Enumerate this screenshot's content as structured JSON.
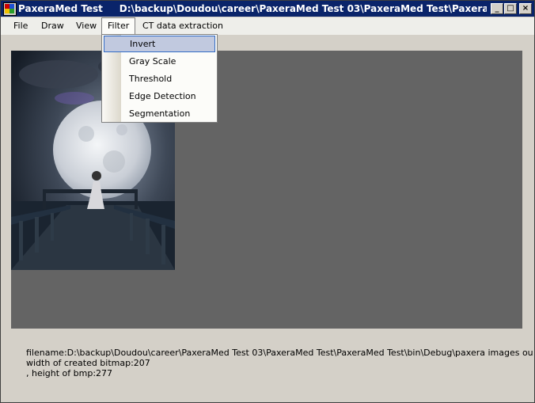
{
  "window": {
    "title": "PaxeraMed Test     D:\\backup\\Doudou\\career\\PaxeraMed Test 03\\PaxeraMed Test\\PaxeraMed Test\\bi...",
    "controls": {
      "minimize": "_",
      "maximize": "□",
      "close": "×"
    }
  },
  "menubar": {
    "items": [
      "File",
      "Draw",
      "View",
      "Filter",
      "CT data extraction"
    ]
  },
  "filter_menu": {
    "items": [
      "Invert",
      "Gray Scale",
      "Threshold",
      "Edge Detection",
      "Segmentation"
    ],
    "highlighted": "Invert"
  },
  "status": {
    "line1": "filename:D:\\backup\\Doudou\\career\\PaxeraMed Test 03\\PaxeraMed Test\\PaxeraMed Test\\bin\\Debug\\paxera images output\\big_moon",
    "line2": "width of created bitmap:207",
    "line3": ", height of bmp:277"
  },
  "colors": {
    "titlebar": "#0a246a",
    "canvas_bg": "#646464",
    "selection": "#c1c9df"
  }
}
